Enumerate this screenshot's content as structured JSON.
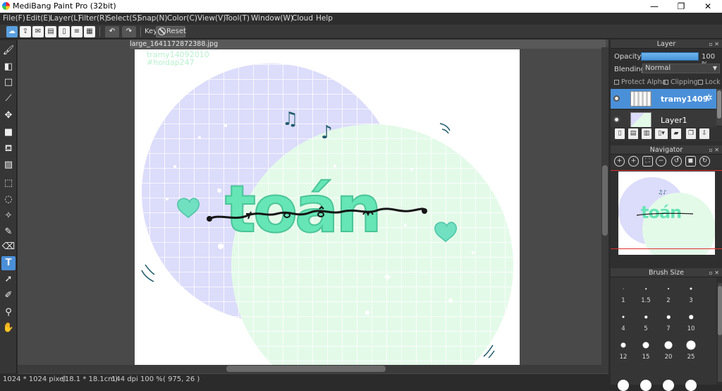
{
  "window": {
    "title": "MediBang Paint Pro (32bit)",
    "min": "—",
    "max": "❐",
    "close": "✕"
  },
  "menu": [
    "File(F)",
    "Edit(E)",
    "Layer(L)",
    "Filter(R)",
    "Select(S)",
    "Snap(N)",
    "Color(C)",
    "View(V)",
    "Tool(T)",
    "Window(W)",
    "Cloud",
    "Help"
  ],
  "toolbar": {
    "key_label": "Key",
    "reset_label": "Reset"
  },
  "document": {
    "tab_title": "large_1641172872388.jpg",
    "watermark_line1": "tramy14092010",
    "watermark_line2": "#hoidap247"
  },
  "status": {
    "size": "1024 * 1024 pixel",
    "physical": "(18.1 * 18.1cm)",
    "dpi": "144 dpi",
    "zoom": "100 %",
    "coords": "( 975, 26 )"
  },
  "layer_panel": {
    "title": "Layer",
    "opacity_label": "Opacity",
    "opacity_value": "100 %",
    "blending_label": "Blending",
    "blending_value": "Normal",
    "protect_alpha": "Protect Alpha",
    "clipping": "Clipping",
    "lock": "Lock",
    "layers": [
      {
        "name": "tramy1409"
      },
      {
        "name": "Layer1"
      }
    ]
  },
  "navigator": {
    "title": "Navigator"
  },
  "brush_size": {
    "title": "Brush Size",
    "labels": [
      "1",
      "1.5",
      "2",
      "3",
      "4",
      "5",
      "7",
      "10",
      "12",
      "15",
      "20",
      "25"
    ]
  },
  "colors": {
    "accent": "#4a90d9",
    "canvas_bg": "#494949",
    "panel_bg": "#2f2f2f"
  }
}
